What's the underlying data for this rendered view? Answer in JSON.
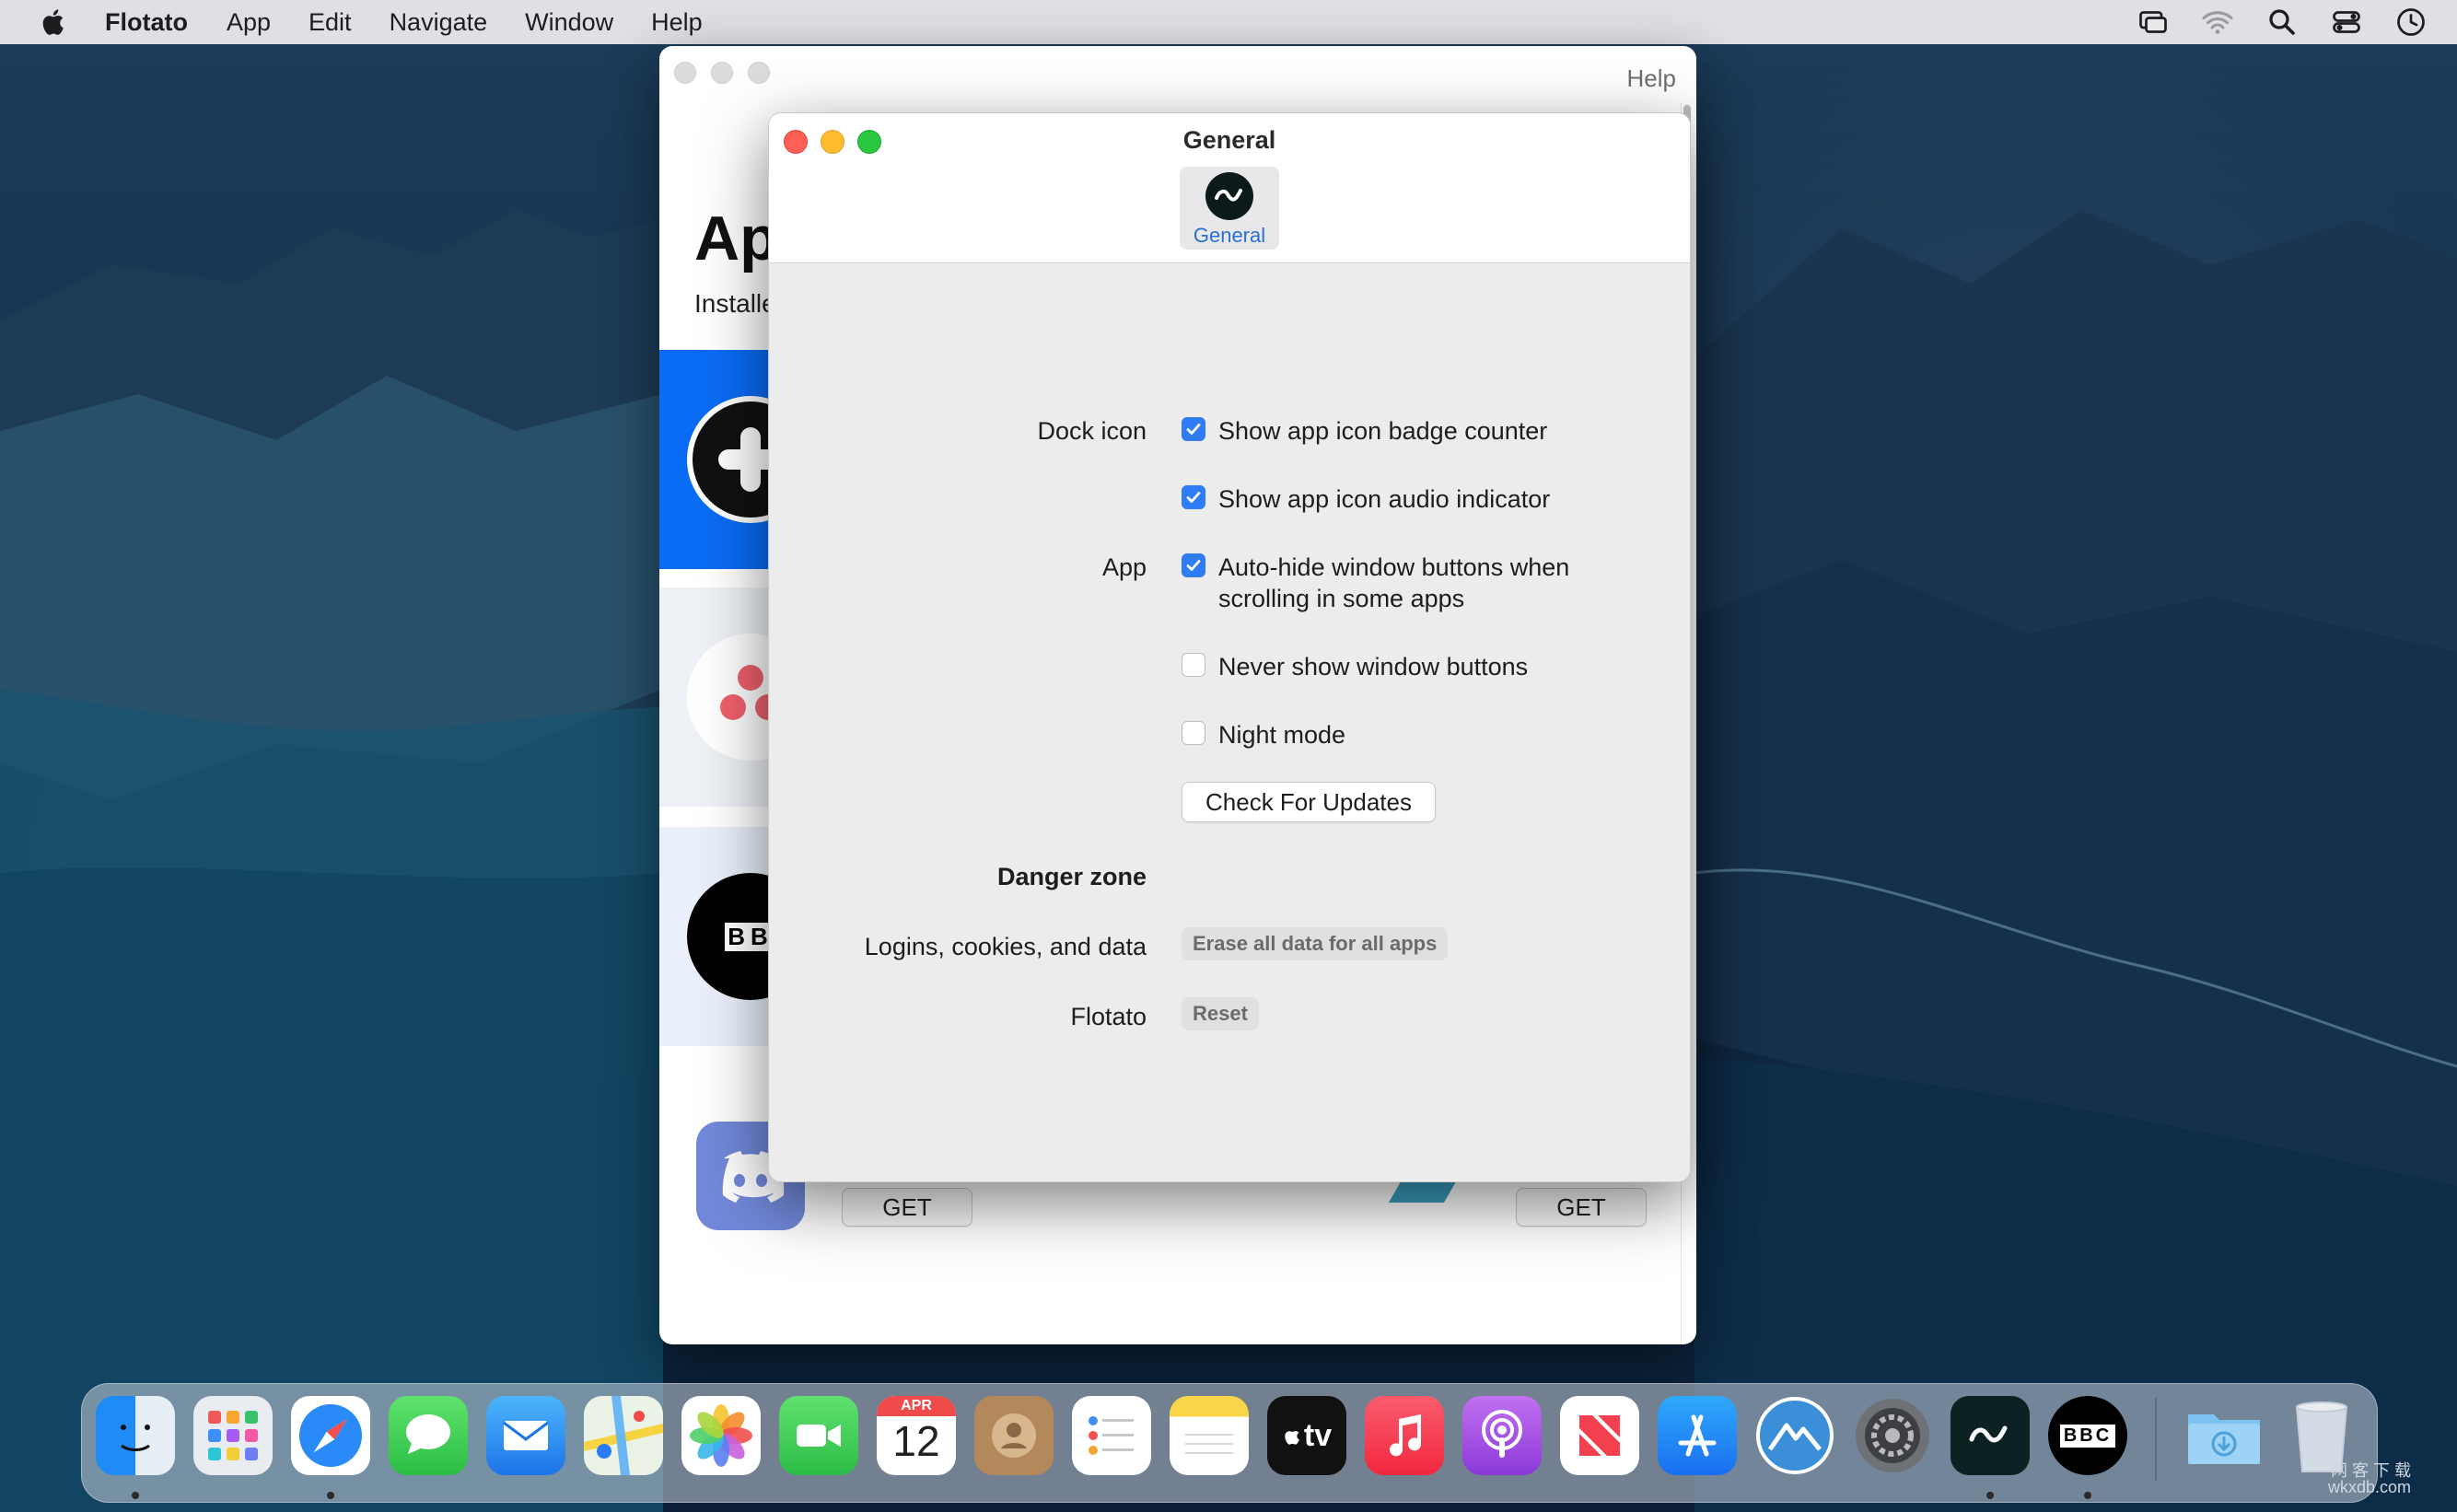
{
  "menubar": {
    "app_name": "Flotato",
    "items": [
      "App",
      "Edit",
      "Navigate",
      "Window",
      "Help"
    ]
  },
  "back_window": {
    "help": "Help",
    "title": "Ap",
    "subtitle": "Installe",
    "get_left": "GET",
    "get_right": "GET",
    "bbc_fragment": "BB"
  },
  "pref": {
    "title": "General",
    "tab_label": "General",
    "labels": {
      "dock_icon": "Dock icon",
      "app": "App",
      "danger_zone": "Danger zone",
      "logins": "Logins, cookies, and data",
      "flotato": "Flotato"
    },
    "options": {
      "badge_counter": "Show app icon badge counter",
      "audio_indicator": "Show app icon audio indicator",
      "autohide": "Auto-hide window buttons when scrolling in some apps",
      "never_show": "Never show window buttons",
      "night_mode": "Night mode"
    },
    "check_updates": "Check For Updates",
    "erase_all": "Erase all data for all apps",
    "reset": "Reset"
  },
  "dock": {
    "calendar_month": "APR",
    "calendar_day": "12",
    "bbc": "BBC",
    "tv": "tv"
  },
  "watermark": {
    "line1": "网 客 下 载",
    "line2": "wkxdb.com"
  },
  "colors": {
    "accent": "#2f7cf6",
    "window_bg": "#ececec",
    "blue_card": "#0a6cf5"
  }
}
